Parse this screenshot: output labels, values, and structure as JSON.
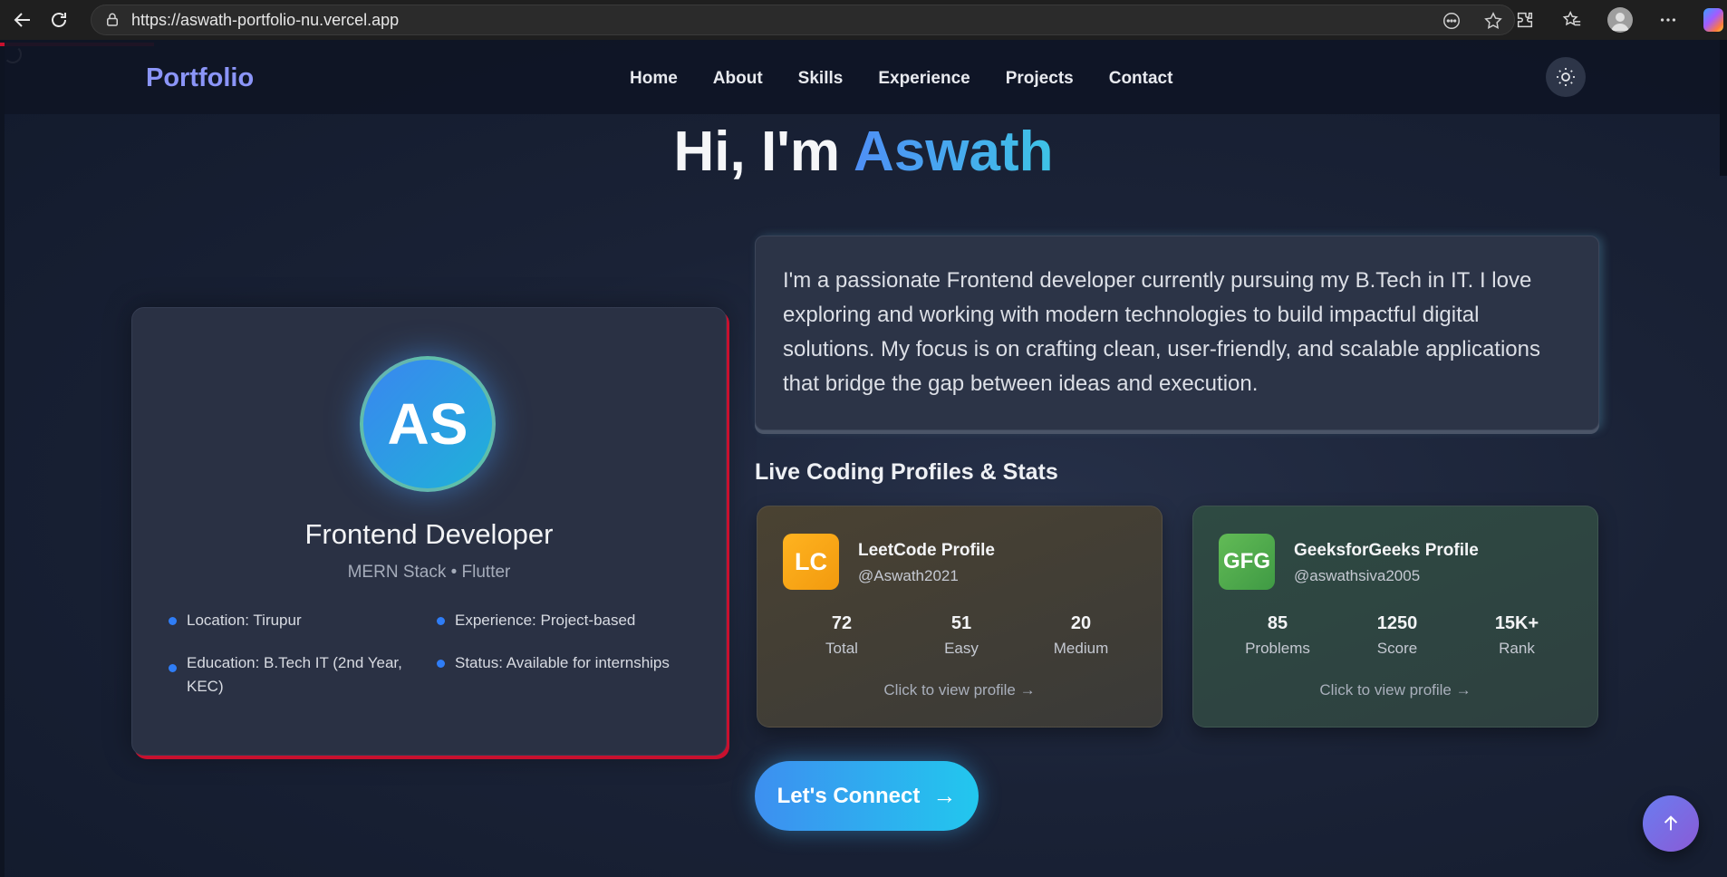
{
  "browser": {
    "url": "https://aswath-portfolio-nu.vercel.app",
    "icons": [
      "back-icon",
      "reload-icon",
      "lock-icon",
      "reader-icon",
      "star-icon",
      "extensions-icon",
      "favorites-icon",
      "profile-icon",
      "more-icon",
      "copilot-icon"
    ]
  },
  "header": {
    "logo": "Portfolio",
    "nav": [
      "Home",
      "About",
      "Skills",
      "Experience",
      "Projects",
      "Contact"
    ],
    "theme_icon": "sun-icon"
  },
  "hero": {
    "greeting": "Hi, I'm",
    "name": "Aswath"
  },
  "profile": {
    "initials": "AS",
    "title": "Frontend Developer",
    "subtitle": "MERN Stack • Flutter",
    "facts": [
      "Location: Tirupur",
      "Experience: Project-based",
      "Education: B.Tech IT (2nd Year, KEC)",
      "Status: Available for internships"
    ]
  },
  "about": {
    "text": "I'm a passionate Frontend developer currently pursuing my B.Tech in IT. I love exploring and working with modern technologies to build impactful digital solutions. My focus is on crafting clean, user-friendly, and scalable applications that bridge the gap between ideas and execution."
  },
  "stats": {
    "heading": "Live Coding Profiles & Stats",
    "leetcode": {
      "badge": "LC",
      "title": "LeetCode Profile",
      "handle": "@Aswath2021",
      "stats": [
        {
          "value": "72",
          "label": "Total"
        },
        {
          "value": "51",
          "label": "Easy"
        },
        {
          "value": "20",
          "label": "Medium"
        }
      ],
      "link": "Click to view profile →",
      "color": "#ffa116"
    },
    "gfg": {
      "badge": "GFG",
      "title": "GeeksforGeeks Profile",
      "handle": "@aswathsiva2005",
      "stats": [
        {
          "value": "85",
          "label": "Problems"
        },
        {
          "value": "1250",
          "label": "Score"
        },
        {
          "value": "15K+",
          "label": "Rank"
        }
      ],
      "link": "Click to view profile →",
      "color": "#4caf50"
    }
  },
  "cta": {
    "label": "Let's Connect",
    "arrow": "→"
  },
  "colors": {
    "accent_blue": "#3d8ff0",
    "accent_cyan": "#22c7ee",
    "logo": "#8b95f8",
    "highlight_red": "#c8102e"
  }
}
